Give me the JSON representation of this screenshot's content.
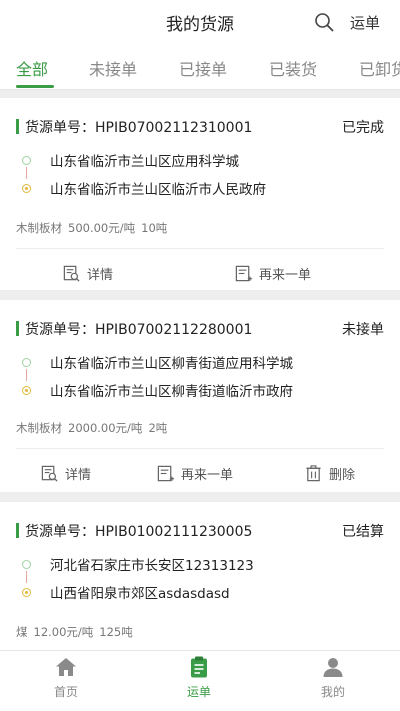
{
  "header": {
    "title": "我的货源",
    "action_label": "运单"
  },
  "tabs": [
    "全部",
    "未接单",
    "已接单",
    "已装货",
    "已卸货"
  ],
  "order_prefix": "货源单号：",
  "cards": [
    {
      "order_no": "HPIB07002112310001",
      "status": "已完成",
      "origin": "山东省临沂市兰山区应用科学城",
      "destination": "山东省临沂市兰山区临沂市人民政府",
      "cargo_name": "木制板材",
      "price": "500.00元/吨",
      "weight": "10吨",
      "actions": [
        "详情",
        "再来一单"
      ]
    },
    {
      "order_no": "HPIB07002112280001",
      "status": "未接单",
      "origin": "山东省临沂市兰山区柳青街道应用科学城",
      "destination": "山东省临沂市兰山区柳青街道临沂市政府",
      "cargo_name": "木制板材",
      "price": "2000.00元/吨",
      "weight": "2吨",
      "actions": [
        "详情",
        "再来一单",
        "删除"
      ]
    },
    {
      "order_no": "HPIB01002111230005",
      "status": "已结算",
      "origin": "河北省石家庄市长安区12313123",
      "destination": "山西省阳泉市郊区asdasdasd",
      "cargo_name": "煤",
      "price": "12.00元/吨",
      "weight": "125吨",
      "actions": []
    }
  ],
  "bottom_nav": [
    "首页",
    "运单",
    "我的"
  ],
  "colors": {
    "accent": "#3a9c46",
    "start_dot": "#9ed19f",
    "end_dot": "#e2b83a"
  }
}
